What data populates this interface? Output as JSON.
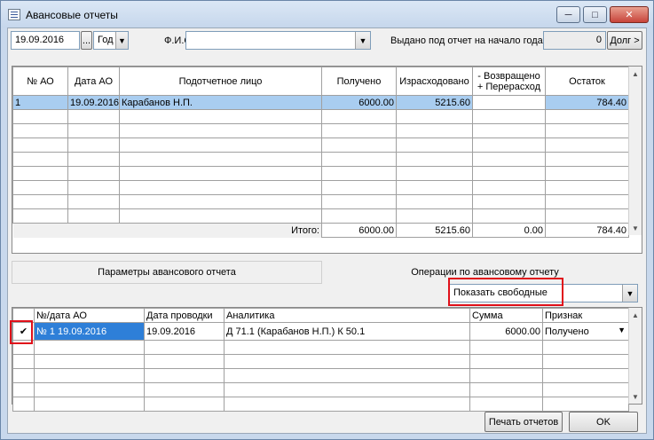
{
  "window": {
    "title": "Авансовые отчеты",
    "minimize_glyph": "─",
    "maximize_glyph": "□",
    "close_glyph": "✕"
  },
  "filters": {
    "date_value": "19.09.2016",
    "date_picker_label": "...",
    "period_value": "Год",
    "fio_label": "Ф.И.О.",
    "fio_value": "",
    "issued_label": "Выдано под отчет на начало года",
    "issued_value": "0",
    "debt_button_label": "Долг >"
  },
  "reports_table": {
    "headers": [
      "№ АО",
      "Дата АО",
      "Подотчетное лицо",
      "Получено",
      "Израсходовано",
      "- Возвращено\n+ Перерасход",
      "Остаток"
    ],
    "rows": [
      [
        "1",
        "19.09.2016",
        "Карабанов Н.П.",
        "6000.00",
        "5215.60",
        "",
        "784.40"
      ]
    ],
    "totals_label": "Итого:",
    "totals": [
      "6000.00",
      "5215.60",
      "0.00",
      "784.40"
    ]
  },
  "tabs": {
    "params_label": "Параметры авансового отчета",
    "operations_label": "Операции по авансовому отчету"
  },
  "operations": {
    "filter_value": "Показать свободные",
    "headers": [
      "",
      "№/дата АО",
      "Дата проводки",
      "Аналитика",
      "Сумма",
      "Признак"
    ],
    "rows": [
      {
        "checked": "✔",
        "ao": "№ 1 19.09.2016",
        "posting_date": "19.09.2016",
        "analytics": "Д 71.1 (Карабанов Н.П.)  К 50.1",
        "amount": "6000.00",
        "sign": "Получено"
      }
    ]
  },
  "footer": {
    "print_button_label": "Печать отчетов",
    "ok_button_label": "OK"
  },
  "colors": {
    "selection": "#a9cdf0",
    "highlight_box": "#e0101a",
    "title_bar": "#c6d7ec"
  }
}
